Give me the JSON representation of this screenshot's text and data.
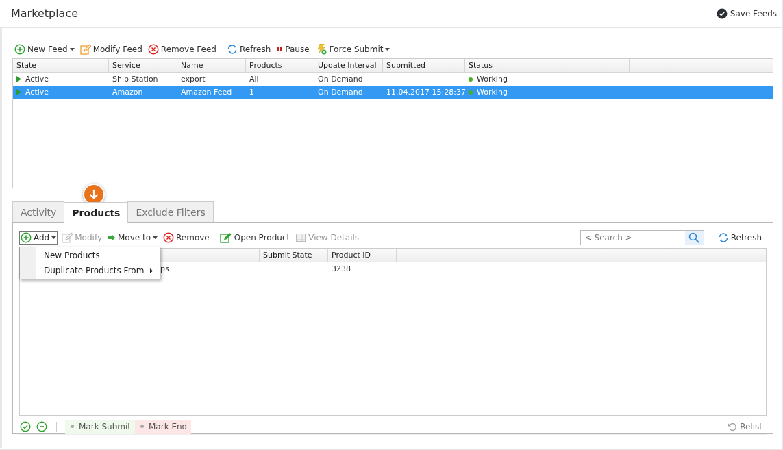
{
  "header": {
    "title": "Marketplace",
    "save_button": "Save Feeds"
  },
  "feed_toolbar": [
    {
      "kind": "add",
      "label": "New Feed",
      "dropdown": true,
      "disabled": false,
      "group_start": false
    },
    {
      "kind": "edit",
      "label": "Modify Feed",
      "dropdown": false,
      "disabled": false,
      "group_start": false
    },
    {
      "kind": "remove",
      "label": "Remove Feed",
      "dropdown": false,
      "disabled": false,
      "group_start": false
    },
    {
      "kind": "refresh",
      "label": "Refresh",
      "dropdown": false,
      "disabled": false,
      "group_start": true
    },
    {
      "kind": "pause",
      "label": "Pause",
      "dropdown": false,
      "disabled": false,
      "group_start": false
    },
    {
      "kind": "force",
      "label": "Force Submit",
      "dropdown": true,
      "disabled": false,
      "group_start": false
    }
  ],
  "feeds": {
    "columns": [
      "State",
      "Service",
      "Name",
      "Products",
      "Update Interval",
      "Submitted",
      "Status"
    ],
    "rows": [
      {
        "selected": false,
        "state": "Active",
        "service": "Ship Station",
        "name": "export",
        "products": "All",
        "update_interval": "On Demand",
        "status": "Working"
      },
      {
        "selected": true,
        "state": "Active",
        "service": "Amazon",
        "name": "Amazon Feed",
        "products": "1",
        "update_interval": "On Demand",
        "submitted": "11.04.2017 15:28:37",
        "status": "Working"
      }
    ]
  },
  "tabs": [
    {
      "label": "Activity",
      "selected": false
    },
    {
      "label": "Products",
      "selected": true
    },
    {
      "label": "Exclude Filters",
      "selected": false
    }
  ],
  "products_toolbar": [
    {
      "kind": "add",
      "label": "Add",
      "dropdown": true,
      "disabled": false,
      "group_start": false,
      "open": true
    },
    {
      "kind": "modify",
      "label": "Modify",
      "dropdown": false,
      "disabled": true,
      "group_start": false,
      "open": false
    },
    {
      "kind": "move",
      "label": "Move to",
      "dropdown": true,
      "disabled": false,
      "group_start": false,
      "open": false
    },
    {
      "kind": "remove",
      "label": "Remove",
      "dropdown": false,
      "disabled": false,
      "group_start": false,
      "open": false
    },
    {
      "kind": "open",
      "label": "Open Product",
      "dropdown": false,
      "disabled": false,
      "group_start": true,
      "open": false
    },
    {
      "kind": "details",
      "label": "View Details",
      "dropdown": false,
      "disabled": true,
      "group_start": false,
      "open": false
    }
  ],
  "search": {
    "placeholder": "< Search >"
  },
  "products_refresh": "Refresh",
  "add_menu": [
    {
      "label": "New Products",
      "submenu": false
    },
    {
      "label": "Duplicate Products From",
      "submenu": true
    }
  ],
  "products": {
    "columns": {
      "column_2": "Submit State",
      "column_3": "Product ID"
    },
    "rows": [
      {
        "column_1": "ps",
        "column_3": "3238"
      }
    ]
  },
  "bottom_bar": {
    "chips": [
      {
        "label": "Mark Submit",
        "color": "#effaec"
      },
      {
        "label": "Mark End",
        "color": "#fde6e6"
      }
    ],
    "relist": {
      "label": "Relist",
      "disabled": true
    }
  }
}
